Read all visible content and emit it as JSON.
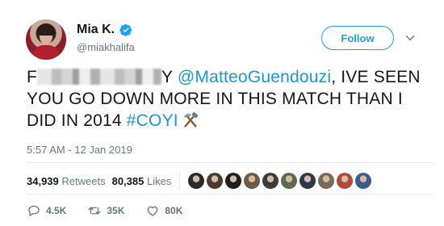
{
  "user": {
    "display_name": "Mia K.",
    "handle": "@miakhalifa"
  },
  "follow_label": "Follow",
  "tweet": {
    "text_prefix": "F",
    "text_after_blur": "Y ",
    "mention": "@MatteoGuendouzi",
    "text_body": ", IVE SEEN YOU GO DOWN MORE IN THIS MATCH THAN I DID IN 2014 ",
    "hashtag": "#COYI",
    "timestamp": "5:57 AM - 12 Jan 2019"
  },
  "stats": {
    "retweets_count": "34,939",
    "retweets_label": "Retweets",
    "likes_count": "80,385",
    "likes_label": "Likes",
    "liker_colors": [
      "#2b2b2b",
      "#4b3a30",
      "#1f1f1f",
      "#6f5a45",
      "#3c3c3c",
      "#5a6b4f",
      "#2e3a46",
      "#7a6a5a",
      "#b04a3a",
      "#3a5e8c"
    ]
  },
  "actions": {
    "replies": "4.5K",
    "retweets": "35K",
    "likes": "80K"
  },
  "colors": {
    "brand_blue": "#1da1f2",
    "link_blue": "#1b95e0",
    "muted_text": "#657786"
  }
}
